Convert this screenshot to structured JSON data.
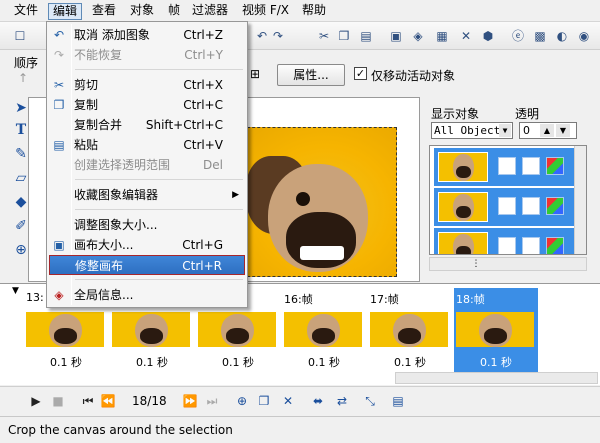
{
  "menubar": {
    "items": [
      "文件",
      "编辑",
      "查看",
      "对象",
      "帧",
      "过滤器",
      "视频 F/X",
      "帮助"
    ]
  },
  "toolbar2": {
    "order_label": "顺序",
    "properties_button": "属性...",
    "move_active_only": "仅移动活动对象",
    "move_active_only_checked": true
  },
  "edit_menu": {
    "items": [
      {
        "label": "取消 添加图象",
        "shortcut": "Ctrl+Z",
        "icon": "undo-icon",
        "disabled": false
      },
      {
        "label": "不能恢复",
        "shortcut": "Ctrl+Y",
        "icon": "redo-icon",
        "disabled": true
      },
      {
        "label": "剪切",
        "shortcut": "Ctrl+X",
        "icon": "scissors-icon",
        "disabled": false
      },
      {
        "label": "复制",
        "shortcut": "Ctrl+C",
        "icon": "copy-icon",
        "disabled": false
      },
      {
        "label": "复制合并",
        "shortcut": "Shift+Ctrl+C",
        "icon": "",
        "disabled": false
      },
      {
        "label": "粘贴",
        "shortcut": "Ctrl+V",
        "icon": "paste-icon",
        "disabled": false
      },
      {
        "label": "创建选择透明范围",
        "shortcut": "Del",
        "icon": "",
        "disabled": true
      },
      {
        "label": "收藏图象编辑器",
        "shortcut": "",
        "icon": "",
        "disabled": false,
        "submenu": true
      },
      {
        "label": "调整图象大小...",
        "shortcut": "",
        "icon": "",
        "disabled": false
      },
      {
        "label": "画布大小...",
        "shortcut": "Ctrl+G",
        "icon": "canvas-size-icon",
        "disabled": false
      },
      {
        "label": "修整画布",
        "shortcut": "Ctrl+R",
        "icon": "",
        "disabled": false,
        "highlighted": true
      },
      {
        "label": "全局信息...",
        "shortcut": "",
        "icon": "global-info-icon",
        "disabled": false
      }
    ]
  },
  "right_panel": {
    "display_object_label": "显示对象",
    "transparency_label": "透明",
    "object_select_value": "All Objects",
    "transparency_value": "0"
  },
  "timeline": {
    "frames": [
      {
        "label": "13:",
        "duration": "0.1 秒",
        "selected": false
      },
      {
        "label": "",
        "duration": "0.1 秒",
        "selected": false
      },
      {
        "label": "",
        "duration": "0.1 秒",
        "selected": false
      },
      {
        "label": "16:帧",
        "duration": "0.1 秒",
        "selected": false
      },
      {
        "label": "17:帧",
        "duration": "0.1 秒",
        "selected": false
      },
      {
        "label": "18:帧",
        "duration": "0.1 秒",
        "selected": true
      }
    ]
  },
  "controls": {
    "frame_counter": "18/18"
  },
  "status": {
    "text": "Crop the canvas around the selection"
  },
  "colors": {
    "selection_blue": "#3b8ee6",
    "highlight_border": "#a6262c",
    "background_yellow": "#f4c000"
  }
}
